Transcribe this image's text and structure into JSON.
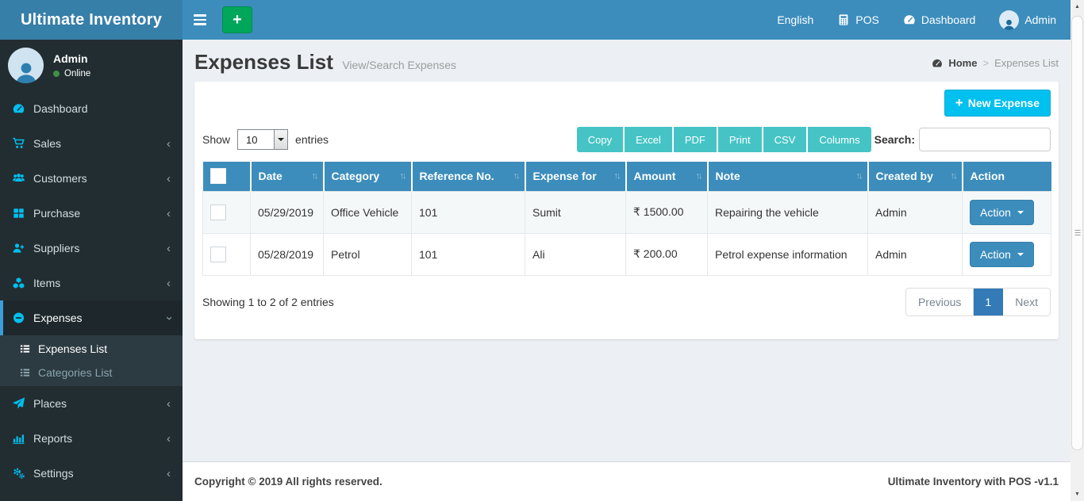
{
  "header": {
    "brand": "Ultimate Inventory",
    "nav": {
      "english": "English",
      "pos": "POS",
      "dashboard": "Dashboard",
      "user": "Admin"
    }
  },
  "sidebar": {
    "user": {
      "name": "Admin",
      "status": "Online"
    },
    "items": [
      {
        "label": "Dashboard"
      },
      {
        "label": "Sales"
      },
      {
        "label": "Customers"
      },
      {
        "label": "Purchase"
      },
      {
        "label": "Suppliers"
      },
      {
        "label": "Items"
      },
      {
        "label": "Expenses"
      },
      {
        "label": "Places"
      },
      {
        "label": "Reports"
      },
      {
        "label": "Settings"
      }
    ],
    "submenu": [
      {
        "label": "Expenses List"
      },
      {
        "label": "Categories List"
      }
    ]
  },
  "content": {
    "title": "Expenses List",
    "subtitle": "View/Search Expenses",
    "breadcrumb": {
      "home": "Home",
      "separator": ">",
      "current": "Expenses List"
    },
    "new_expense_label": "New Expense",
    "show_label": "Show",
    "entries_value": "10",
    "entries_label": "entries",
    "export_buttons": [
      "Copy",
      "Excel",
      "PDF",
      "Print",
      "CSV",
      "Columns"
    ],
    "search_label": "Search:",
    "table": {
      "columns": [
        "Date",
        "Category",
        "Reference No.",
        "Expense for",
        "Amount",
        "Note",
        "Created by",
        "Action"
      ],
      "rows": [
        {
          "date": "05/29/2019",
          "category": "Office Vehicle",
          "reference": "101",
          "expense_for": "Sumit",
          "amount": "₹ 1500.00",
          "note": "Repairing the vehicle",
          "created_by": "Admin",
          "action": "Action"
        },
        {
          "date": "05/28/2019",
          "category": "Petrol",
          "reference": "101",
          "expense_for": "Ali",
          "amount": "₹ 200.00",
          "note": "Petrol expense information",
          "created_by": "Admin",
          "action": "Action"
        }
      ]
    },
    "info": "Showing 1 to 2 of 2 entries",
    "pagination": {
      "previous": "Previous",
      "page": "1",
      "next": "Next"
    }
  },
  "footer": {
    "left": "Copyright © 2019 All rights reserved.",
    "right": "Ultimate Inventory with POS -v1.1"
  },
  "icons": {
    "plus": "+",
    "chevron": "‹",
    "sort": "↑↓",
    "scroll_up": "▲",
    "scroll_down": "▼"
  },
  "colors": {
    "navbar": "#3c8dbc",
    "brand": "#367fa9",
    "sidebar": "#222d32",
    "sidebar_active": "#1e282c",
    "icon_cyan": "#00bfef",
    "green_add": "#00a65a",
    "info_cyan": "#00c0ef",
    "teal_export": "#46c4c5",
    "table_header": "#3c8dbc",
    "pagination_active": "#337ab7",
    "body_bg": "#ecf0f5",
    "online_green": "#3f8f46"
  }
}
